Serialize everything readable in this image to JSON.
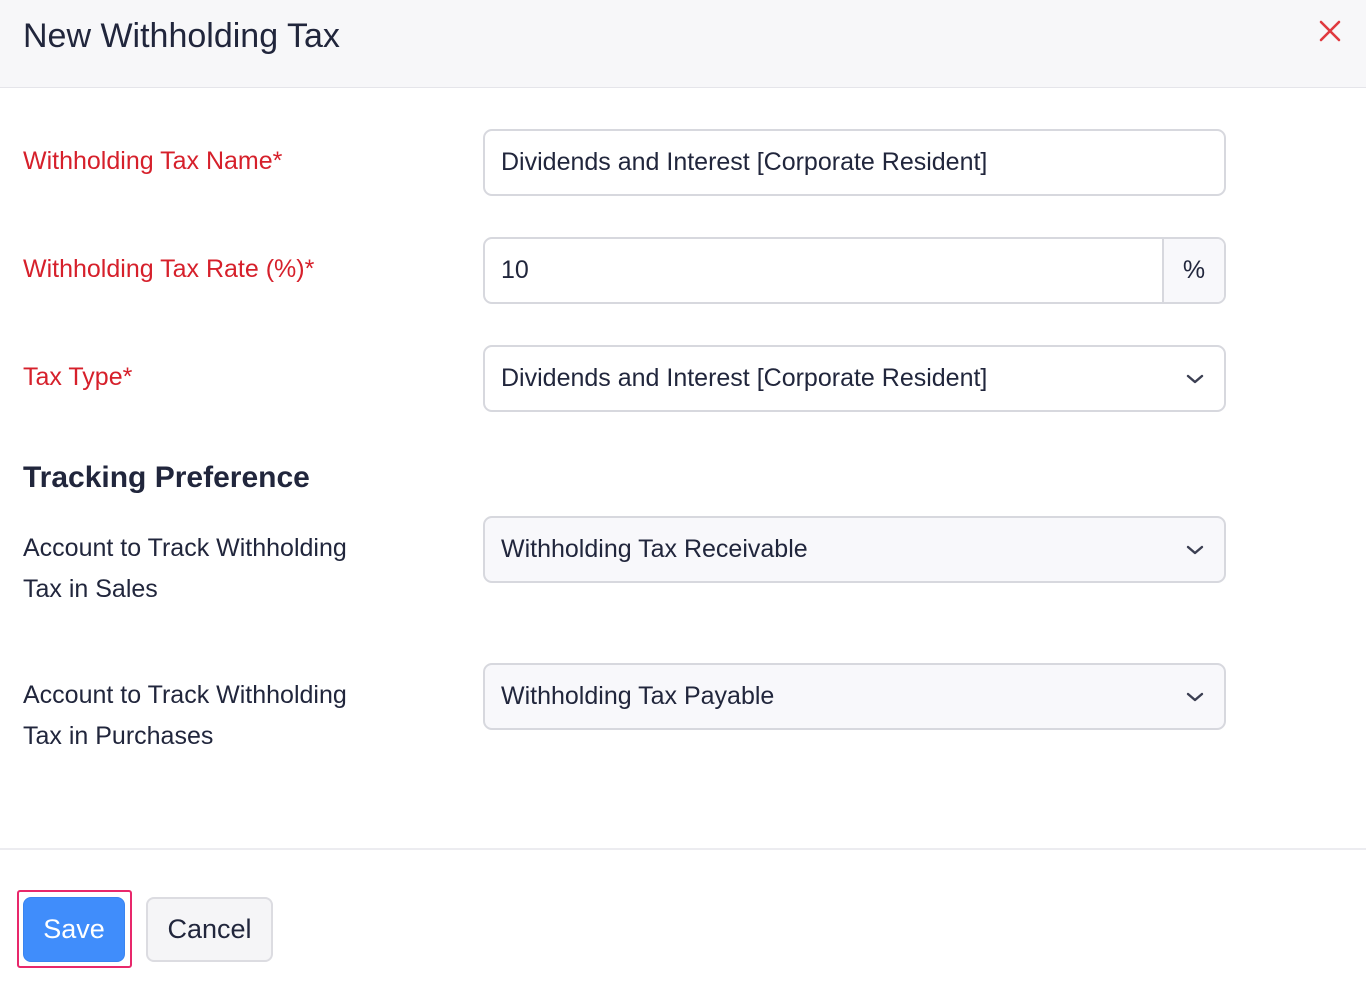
{
  "header": {
    "title": "New Withholding Tax"
  },
  "form": {
    "tax_name": {
      "label": "Withholding Tax Name*",
      "value": "Dividends and Interest [Corporate Resident]"
    },
    "tax_rate": {
      "label": "Withholding Tax Rate (%)*",
      "value": "10",
      "suffix": "%"
    },
    "tax_type": {
      "label": "Tax Type*",
      "value": "Dividends and Interest [Corporate Resident]"
    }
  },
  "tracking": {
    "title": "Tracking Preference",
    "sales": {
      "label_line1": "Account to Track Withholding",
      "label_line2": "Tax in Sales",
      "value": "Withholding Tax Receivable"
    },
    "purchases": {
      "label_line1": "Account to Track Withholding",
      "label_line2": "Tax in Purchases",
      "value": "Withholding Tax Payable"
    }
  },
  "footer": {
    "save_label": "Save",
    "cancel_label": "Cancel"
  },
  "colors": {
    "required": "#d6202b",
    "primary": "#408dfb",
    "focus_ring": "#e8286b",
    "close": "#e0393e"
  }
}
